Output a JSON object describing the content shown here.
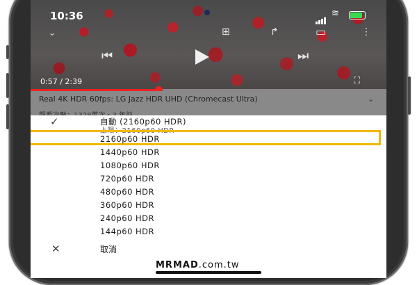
{
  "status_bar": {
    "time": "10:36"
  },
  "video": {
    "timecode": "0:57 / 2:39",
    "progress_fraction": 0.36,
    "title": "Real 4K HDR 60fps: LG Jazz HDR UHD (Chromecast Ultra)",
    "subtitle": "觀看次數：1328萬次・3 年前"
  },
  "quality_menu": {
    "auto_label": "自動 (2160p60 HDR)",
    "auto_sub": "上限：2160p60 HDR",
    "options": [
      "2160p60 HDR",
      "1440p60 HDR",
      "1080p60 HDR",
      "720p60 HDR",
      "480p60 HDR",
      "360p60 HDR",
      "240p60 HDR",
      "144p60 HDR"
    ],
    "highlight_color": "#f3b800",
    "cancel_label": "取消"
  },
  "watermark": {
    "brand": "MRMAD",
    "domain": ".com.tw"
  },
  "icons": {
    "checkmark": "✓",
    "close": "✕",
    "chevron_down": "⌄",
    "prev": "⏮",
    "next": "⏭",
    "cast": "▭",
    "share": "↱",
    "add_playlist": "⊞",
    "more": "⋮",
    "fullscreen": "⛶",
    "wifi": "≋"
  }
}
